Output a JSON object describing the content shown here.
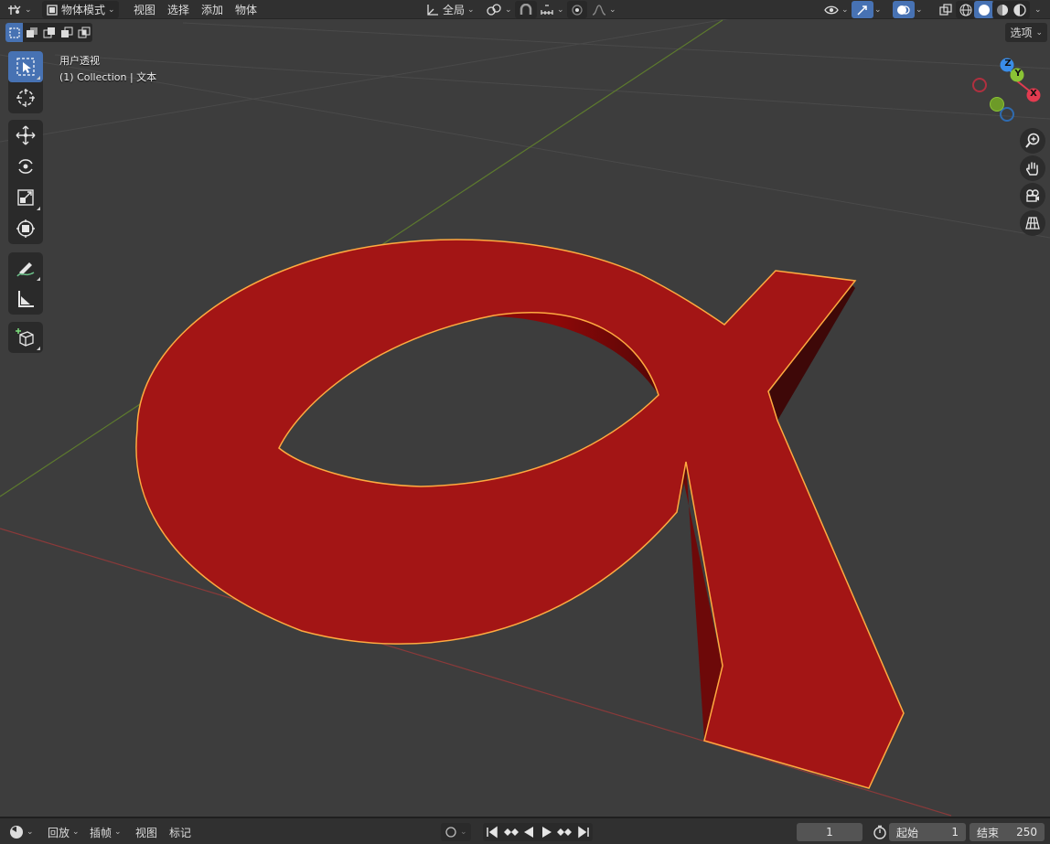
{
  "header": {
    "mode_label": "物体模式",
    "menus": [
      "视图",
      "选择",
      "添加",
      "物体"
    ],
    "transform_orientation": "全局"
  },
  "viewport": {
    "title": "用户透视",
    "subtitle": "(1) Collection | 文本",
    "options_label": "选项"
  },
  "gizmo": {
    "x": "X",
    "y": "Y",
    "z": "Z"
  },
  "timeline": {
    "playback": "回放",
    "keying": "插帧",
    "view": "视图",
    "marker": "标记",
    "current_frame": "1",
    "start_label": "起始",
    "start_value": "1",
    "end_label": "结束",
    "end_value": "250"
  },
  "colors": {
    "object_red": "#9c0d0d",
    "selection_outline": "#ffaa40",
    "accent": "#4772b3",
    "x_axis": "#e33b50",
    "y_axis": "#8ac335",
    "z_axis": "#3a8de8"
  },
  "icons": {
    "tools": [
      "select-box-icon",
      "cursor-icon",
      "move-icon",
      "rotate-icon",
      "scale-icon",
      "transform-icon",
      "annotate-icon",
      "measure-icon",
      "add-cube-icon"
    ],
    "nav": [
      "zoom-icon",
      "hand-icon",
      "camera-icon",
      "grid-ortho-icon"
    ]
  }
}
